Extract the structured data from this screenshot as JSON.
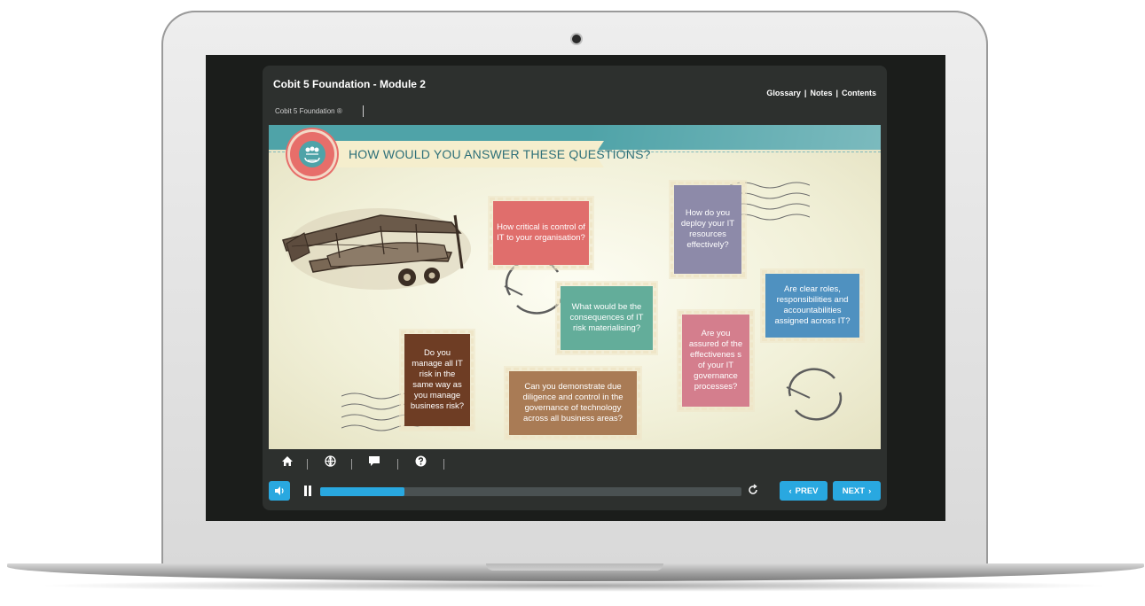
{
  "header": {
    "title": "Cobit 5 Foundation - Module 2",
    "subtitle": "Cobit 5 Foundation ®",
    "links": [
      "Glossary",
      "Notes",
      "Contents"
    ],
    "separator": "|"
  },
  "slide": {
    "heading": "HOW WOULD YOU ANSWER THESE QUESTIONS?",
    "cards": [
      {
        "text": "How critical is control of IT to your organisation?",
        "color": "#e06e6c"
      },
      {
        "text": "What would be the consequences of IT risk materialising?",
        "color": "#63ad9a"
      },
      {
        "text": "How do you deploy your IT resources effectively?",
        "color": "#8d8aa9"
      },
      {
        "text": "Are clear roles, responsibilities and accountabilities assigned across IT?",
        "color": "#4f91c0"
      },
      {
        "text": "Are you assured of the effectivenes s of your IT governance processes?",
        "color": "#d47e8d"
      },
      {
        "text": "Do you manage all IT risk in the same way as you manage business risk?",
        "color": "#6e3d24"
      },
      {
        "text": "Can you demonstrate due diligence and control in the governance of technology across all business areas?",
        "color": "#a97b55"
      }
    ]
  },
  "toolbar": {
    "icons": [
      "home-icon",
      "globe-icon",
      "chat-icon",
      "help-icon"
    ]
  },
  "player": {
    "progress": 0.2,
    "prev_label": "PREV",
    "next_label": "NEXT"
  },
  "colors": {
    "accent": "#29a8e0",
    "app_bg": "#2d302e",
    "band": "#4fa3a8",
    "banner_text": "#2d6f78"
  }
}
